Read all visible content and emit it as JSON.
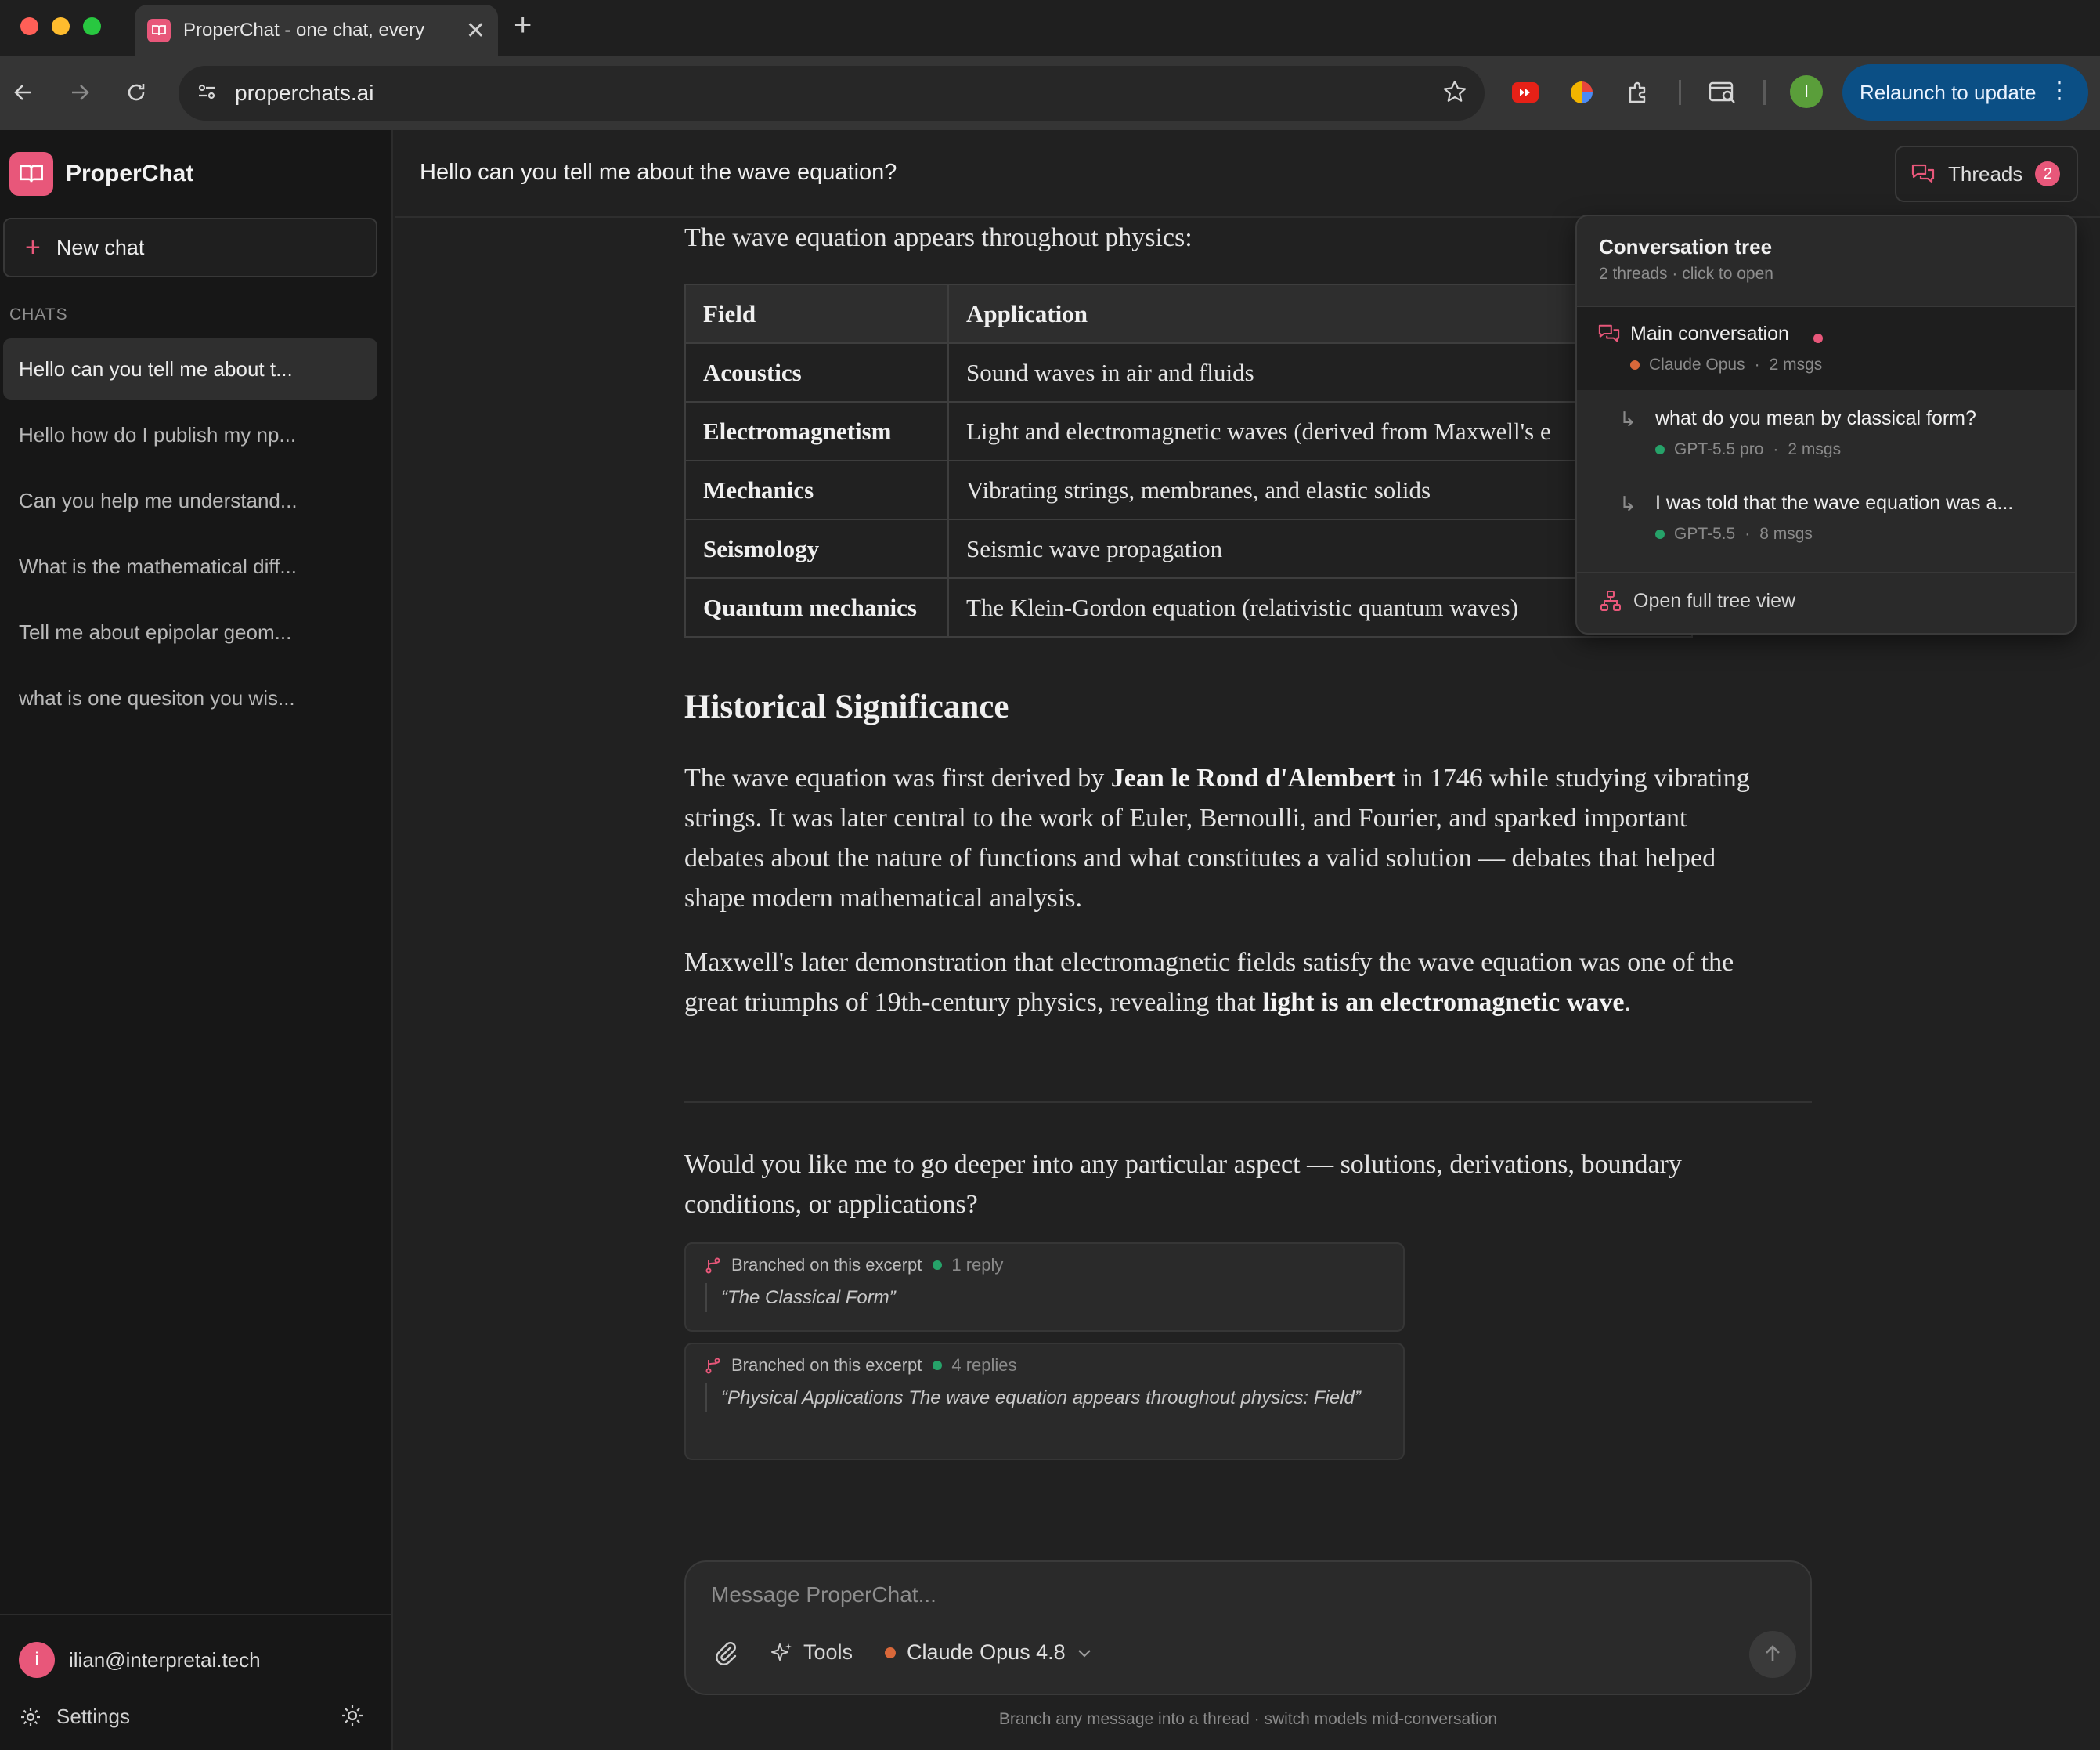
{
  "browser": {
    "tab_title": "ProperChat - one chat, every",
    "url": "properchats.ai",
    "relaunch_label": "Relaunch to update",
    "profile_initial": "I"
  },
  "sidebar": {
    "brand": "ProperChat",
    "new_chat_label": "New chat",
    "section_label": "CHATS",
    "chats": [
      {
        "label": "Hello can you tell me about t..."
      },
      {
        "label": "Hello how do I publish my np..."
      },
      {
        "label": "Can you help me understand..."
      },
      {
        "label": "What is the mathematical diff..."
      },
      {
        "label": "Tell me about epipolar geom..."
      },
      {
        "label": "what is one quesiton you wis..."
      }
    ],
    "user_initial": "i",
    "user_email": "ilian@interpretai.tech",
    "settings_label": "Settings"
  },
  "header": {
    "title": "Hello can you tell me about the wave equation?",
    "threads_label": "Threads",
    "threads_count": "2"
  },
  "message": {
    "intro": "The wave equation appears throughout physics:",
    "table": {
      "headers": [
        "Field",
        "Application"
      ],
      "rows": [
        [
          "Acoustics",
          "Sound waves in air and fluids"
        ],
        [
          "Electromagnetism",
          "Light and electromagnetic waves (derived from Maxwell's e"
        ],
        [
          "Mechanics",
          "Vibrating strings, membranes, and elastic solids"
        ],
        [
          "Seismology",
          "Seismic wave propagation"
        ],
        [
          "Quantum mechanics",
          "The Klein-Gordon equation (relativistic quantum waves)"
        ]
      ]
    },
    "section_title": "Historical Significance",
    "p1_a": "The wave equation was first derived by ",
    "p1_b": "Jean le Rond d'Alembert",
    "p1_c": " in 1746 while studying vibrating strings. It was later central to the work of Euler, Bernoulli, and Fourier, and sparked important debates about the nature of functions and what constitutes a valid solution — debates that helped shape modern mathematical analysis.",
    "p2_a": "Maxwell's later demonstration that electromagnetic fields satisfy the wave equation was one of the great triumphs of 19th-century physics, revealing that ",
    "p2_b": "light is an electromagnetic wave",
    "p2_c": ".",
    "followup": "Would you like me to go deeper into any particular aspect — solutions, derivations, boundary conditions, or applications?"
  },
  "branches": [
    {
      "label": "Branched on this excerpt",
      "replies": "1 reply",
      "quote": "“The Classical Form”"
    },
    {
      "label": "Branched on this excerpt",
      "replies": "4 replies",
      "quote": "“Physical Applications The wave equation appears throughout physics: Field”"
    }
  ],
  "composer": {
    "placeholder": "Message ProperChat...",
    "tools_label": "Tools",
    "model_label": "Claude Opus 4.8",
    "footnote": "Branch any message into a thread · switch models mid-conversation"
  },
  "tree": {
    "title": "Conversation tree",
    "subtitle": "2 threads · click to open",
    "nodes": [
      {
        "title": "Main conversation",
        "model": "Claude Opus",
        "msgs": "2 msgs",
        "color": "#d9683a"
      },
      {
        "title": "what do you mean by classical form?",
        "model": "GPT-5.5 pro",
        "msgs": "2 msgs",
        "color": "#26a269"
      },
      {
        "title": "I was told that the wave equation was a...",
        "model": "GPT-5.5",
        "msgs": "8 msgs",
        "color": "#26a269"
      }
    ],
    "open_full_label": "Open full tree view"
  },
  "colors": {
    "accent": "#e8577a",
    "relaunch": "#0b4f85",
    "claude_dot": "#d9683a",
    "gpt_dot": "#26a269"
  }
}
